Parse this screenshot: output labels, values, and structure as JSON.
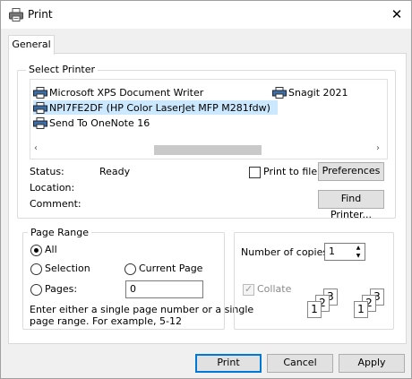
{
  "window": {
    "title": "Print",
    "close_glyph": "✕"
  },
  "tabs": [
    {
      "label": "General"
    }
  ],
  "select_printer": {
    "label": "Select Printer",
    "printers": [
      {
        "name": "Microsoft XPS Document Writer"
      },
      {
        "name": "Snagit 2021"
      },
      {
        "name": "NPI7FE2DF (HP Color LaserJet MFP M281fdw)",
        "selected": true
      },
      {
        "name": "Send To OneNote 16"
      }
    ],
    "status_label": "Status:",
    "status_value": "Ready",
    "location_label": "Location:",
    "comment_label": "Comment:",
    "print_to_file_label": "Print to file",
    "preferences_label": "Preferences",
    "find_printer_label": "Find Printer..."
  },
  "page_range": {
    "label": "Page Range",
    "all_label": "All",
    "selection_label": "Selection",
    "current_page_label": "Current Page",
    "pages_label": "Pages:",
    "pages_value": "0",
    "help_line1": "Enter either a single page number or a single",
    "help_line2": "page range.  For example, 5-12",
    "selected_option": "All"
  },
  "copies": {
    "label": "Number of copies:",
    "value": "1",
    "collate_label": "Collate",
    "collate_checked": true,
    "collate_enabled": false,
    "collate_digits_a": [
      "1",
      "2",
      "3"
    ],
    "collate_digits_b": [
      "1",
      "2",
      "3"
    ]
  },
  "footer": {
    "print_label": "Print",
    "cancel_label": "Cancel",
    "apply_label": "Apply"
  },
  "icons": {
    "printer": "printer-icon",
    "close": "close-icon"
  },
  "colors": {
    "selection": "#cce8ff",
    "accent": "#0078d7"
  }
}
